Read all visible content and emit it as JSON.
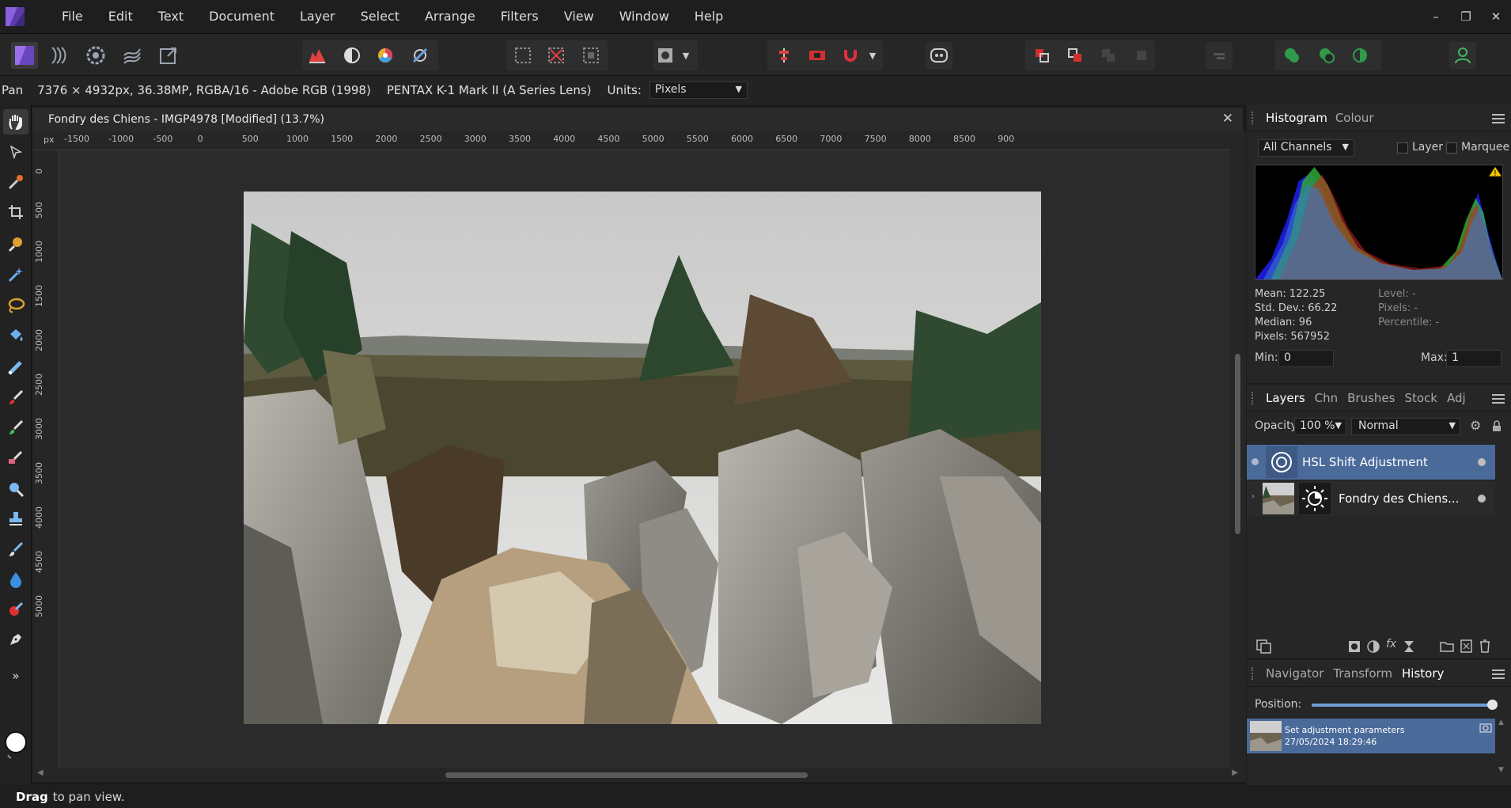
{
  "menubar": {
    "items": [
      "File",
      "Edit",
      "Text",
      "Document",
      "Layer",
      "Select",
      "Arrange",
      "Filters",
      "View",
      "Window",
      "Help"
    ]
  },
  "window_controls": {
    "minimize": "–",
    "restore": "❐",
    "close": "✕"
  },
  "context": {
    "tool": "Pan",
    "info": "7376 × 4932px, 36.38MP, RGBA/16 - Adobe RGB (1998)",
    "camera": "PENTAX K-1 Mark II (A Series Lens)",
    "units_label": "Units:",
    "units_value": "Pixels"
  },
  "document": {
    "title": "Fondry des Chiens - IMGP4978 [Modified] (13.7%)",
    "ruler_unit": "px",
    "ruler_top": [
      "-1500",
      "-1000",
      "-500",
      "0",
      "500",
      "1000",
      "1500",
      "2000",
      "2500",
      "3000",
      "3500",
      "4000",
      "4500",
      "5000",
      "5500",
      "6000",
      "6500",
      "7000",
      "7500",
      "8000",
      "8500",
      "900"
    ],
    "ruler_left": [
      "0",
      "500",
      "1000",
      "1500",
      "2000",
      "2500",
      "3000",
      "3500",
      "4000",
      "4500",
      "5000"
    ]
  },
  "histogram": {
    "tabs": [
      "Histogram",
      "Colour"
    ],
    "channel": "All Channels",
    "layer_label": "Layer",
    "marquee_label": "Marquee",
    "stats": {
      "mean": "Mean: 122.25",
      "std": "Std. Dev.: 66.22",
      "median": "Median: 96",
      "pixels": "Pixels: 567952",
      "level": "Level: -",
      "pixels_sel": "Pixels: -",
      "percentile": "Percentile: -"
    },
    "min_label": "Min:",
    "min_value": "0",
    "max_label": "Max:",
    "max_value": "1"
  },
  "layers": {
    "tabs": [
      "Layers",
      "Chn",
      "Brushes",
      "Stock",
      "Adj"
    ],
    "opacity_label": "Opacity:",
    "opacity_value": "100 %",
    "blend_mode": "Normal",
    "items": [
      {
        "name": "HSL Shift Adjustment",
        "selected": true
      },
      {
        "name": "Fondry des Chiens...",
        "selected": false
      }
    ]
  },
  "history": {
    "tabs": [
      "Navigator",
      "Transform",
      "History"
    ],
    "position_label": "Position:",
    "entry_title": "Set adjustment parameters",
    "entry_time": "27/05/2024 18:29:46"
  },
  "status": {
    "strong": "Drag",
    "text": "to pan view."
  },
  "colors": {
    "accent": "#4a6a9a",
    "brand": "#7b4fc9"
  }
}
